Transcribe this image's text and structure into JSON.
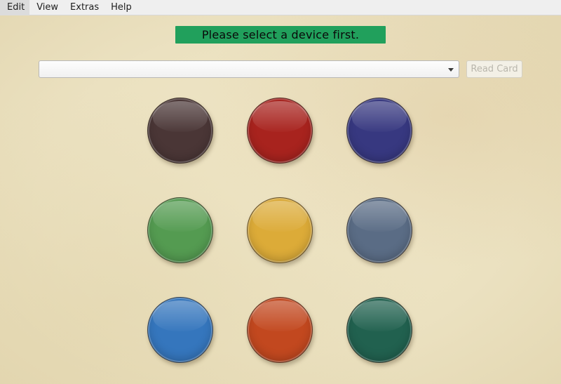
{
  "menu": {
    "items": [
      "Edit",
      "View",
      "Extras",
      "Help"
    ]
  },
  "status": {
    "message": "Please select a device first."
  },
  "device_select": {
    "value": ""
  },
  "read_card": {
    "label": "Read Card",
    "enabled": false
  },
  "color_buttons": [
    {
      "name": "dark-brown",
      "color": "#4a3636"
    },
    {
      "name": "red",
      "color": "#a8231e"
    },
    {
      "name": "navy",
      "color": "#373880"
    },
    {
      "name": "green",
      "color": "#549b51"
    },
    {
      "name": "yellow",
      "color": "#dcab38"
    },
    {
      "name": "slate",
      "color": "#5a6c85"
    },
    {
      "name": "blue",
      "color": "#3576bd"
    },
    {
      "name": "orange",
      "color": "#c2481f"
    },
    {
      "name": "teal",
      "color": "#21614f"
    }
  ]
}
